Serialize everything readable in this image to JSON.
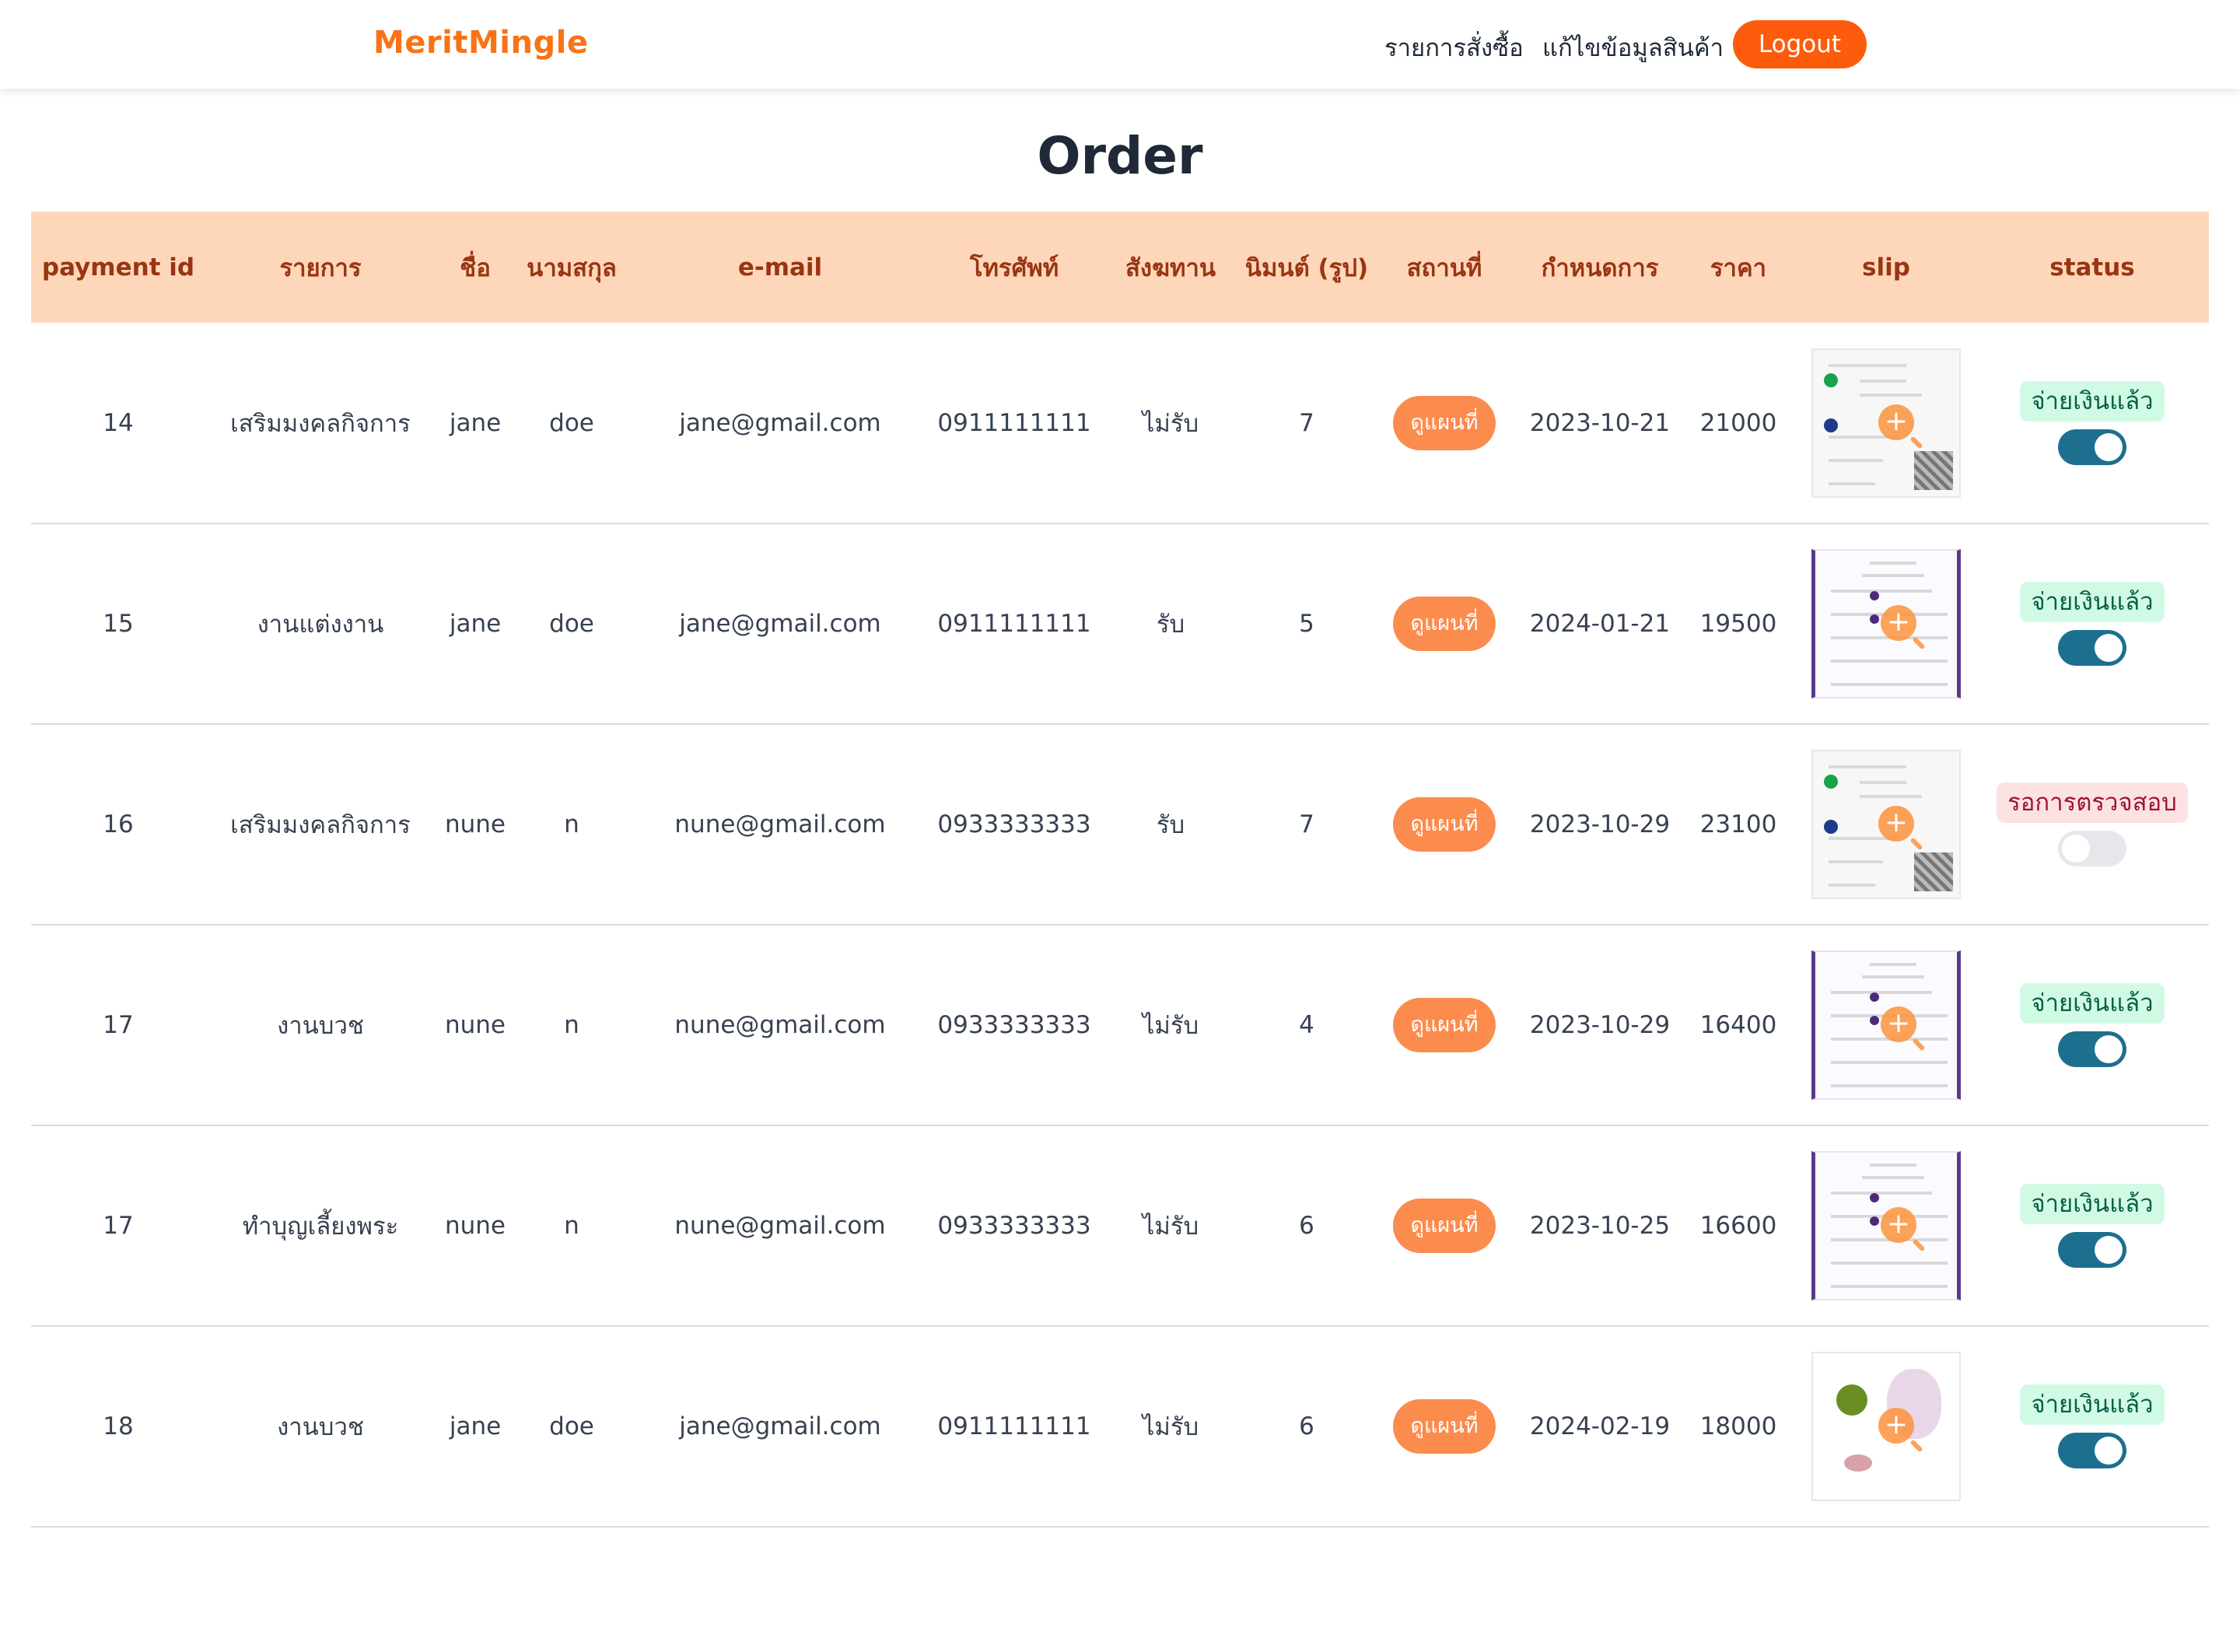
{
  "nav": {
    "brand": "MeritMingle",
    "orders_link": "รายการสั่งซื้อ",
    "edit_link": "แก้ไขข้อมูลสินค้า",
    "logout": "Logout"
  },
  "page": {
    "title": "Order"
  },
  "colors": {
    "brand": "#f97316",
    "header_bg": "#fed7ba",
    "header_text": "#9a3412",
    "map_button": "#fb8c4e",
    "toggle_on": "#1d6f8f",
    "paid_badge_bg": "#d1fae5",
    "pending_badge_bg": "#fde2e4"
  },
  "table": {
    "columns": [
      "payment id",
      "รายการ",
      "ชื่อ",
      "นามสกุล",
      "e-mail",
      "โทรศัพท์",
      "สังฆทาน",
      "นิมนต์ (รูป)",
      "สถานที่",
      "กำหนดการ",
      "ราคา",
      "slip",
      "status"
    ],
    "map_button_label": "ดูแผนที่",
    "rows": [
      {
        "payment_id": "14",
        "item": "เสริมมงคลกิจการ",
        "first_name": "jane",
        "last_name": "doe",
        "email": "jane@gmail.com",
        "phone": "0911111111",
        "offering": "ไม่รับ",
        "monks": "7",
        "date": "2023-10-21",
        "price": "21000",
        "slip_icon": "bank-slip-kbank",
        "status": "จ่ายเงินแล้ว",
        "paid": true
      },
      {
        "payment_id": "15",
        "item": "งานแต่งงาน",
        "first_name": "jane",
        "last_name": "doe",
        "email": "jane@gmail.com",
        "phone": "0911111111",
        "offering": "รับ",
        "monks": "5",
        "date": "2024-01-21",
        "price": "19500",
        "slip_icon": "bank-slip-transfer",
        "status": "จ่ายเงินแล้ว",
        "paid": true
      },
      {
        "payment_id": "16",
        "item": "เสริมมงคลกิจการ",
        "first_name": "nune",
        "last_name": "n",
        "email": "nune@gmail.com",
        "phone": "0933333333",
        "offering": "รับ",
        "monks": "7",
        "date": "2023-10-29",
        "price": "23100",
        "slip_icon": "bank-slip-kbank",
        "status": "รอการตรวจสอบ",
        "paid": false
      },
      {
        "payment_id": "17",
        "item": "งานบวช",
        "first_name": "nune",
        "last_name": "n",
        "email": "nune@gmail.com",
        "phone": "0933333333",
        "offering": "ไม่รับ",
        "monks": "4",
        "date": "2023-10-29",
        "price": "16400",
        "slip_icon": "bank-slip-transfer",
        "status": "จ่ายเงินแล้ว",
        "paid": true
      },
      {
        "payment_id": "17",
        "item": "ทำบุญเลี้ยงพระ",
        "first_name": "nune",
        "last_name": "n",
        "email": "nune@gmail.com",
        "phone": "0933333333",
        "offering": "ไม่รับ",
        "monks": "6",
        "date": "2023-10-25",
        "price": "16600",
        "slip_icon": "bank-slip-transfer",
        "status": "จ่ายเงินแล้ว",
        "paid": true
      },
      {
        "payment_id": "18",
        "item": "งานบวช",
        "first_name": "jane",
        "last_name": "doe",
        "email": "jane@gmail.com",
        "phone": "0911111111",
        "offering": "ไม่รับ",
        "monks": "6",
        "date": "2024-02-19",
        "price": "18000",
        "slip_icon": "garlic-illustration",
        "status": "จ่ายเงินแล้ว",
        "paid": true
      }
    ]
  }
}
